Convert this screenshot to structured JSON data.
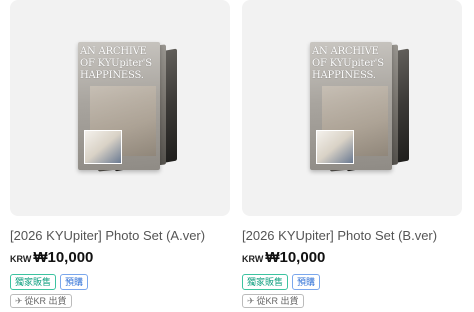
{
  "products": [
    {
      "title": "[2026 KYUpiter] Photo Set (A.ver)",
      "cover_text": "AN ARCHIVE OF KYUpiter'S HAPPINESS.",
      "currency": "KRW",
      "price": "₩10,000",
      "badges": {
        "exclusive": "獨家販售",
        "preorder": "預購"
      },
      "shipping": "從KR 出貨"
    },
    {
      "title": "[2026 KYUpiter] Photo Set (B.ver)",
      "cover_text": "AN ARCHIVE OF KYUpiter'S HAPPINESS.",
      "currency": "KRW",
      "price": "₩10,000",
      "badges": {
        "exclusive": "獨家販售",
        "preorder": "預購"
      },
      "shipping": "從KR 出貨"
    }
  ],
  "colors": {
    "exclusive": "#0f9f7f",
    "preorder": "#2d6fd6",
    "thumb_bg": "#f2f2f2"
  },
  "icons": {
    "shipping": "airplane-icon"
  }
}
